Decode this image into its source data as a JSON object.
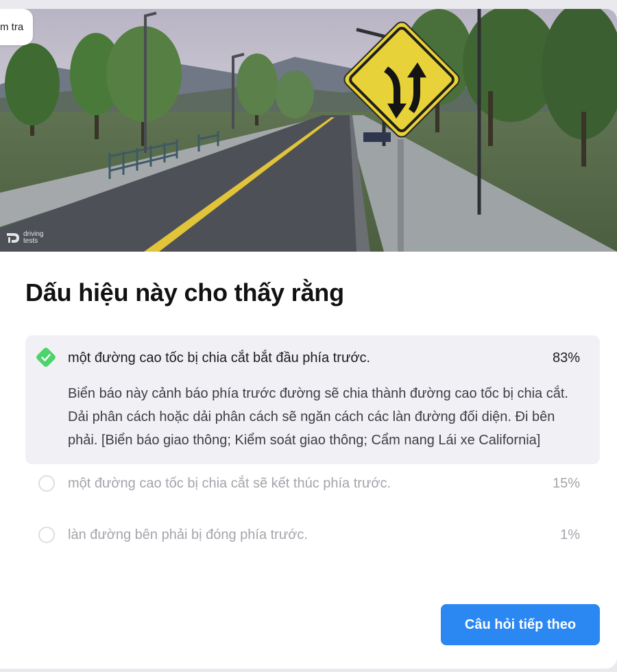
{
  "hero": {
    "badge_text": "m tra",
    "watermark_line1": "driving",
    "watermark_line2": "tests"
  },
  "question": {
    "title": "Dấu hiệu này cho thấy rằng"
  },
  "answers": [
    {
      "text": "một đường cao tốc bị chia cắt bắt đầu phía trước.",
      "percent": "83%",
      "state": "correct",
      "explanation": "Biển báo này cảnh báo phía trước đường sẽ chia thành đường cao tốc bị chia cắt. Dải phân cách hoặc dải phân cách sẽ ngăn cách các làn đường đối diện. Đi bên phải. [Biển báo giao thông; Kiểm soát giao thông; Cẩm nang Lái xe California]"
    },
    {
      "text": "một đường cao tốc bị chia cắt sẽ kết thúc phía trước.",
      "percent": "15%",
      "state": "unselected"
    },
    {
      "text": "làn đường bên phải bị đóng phía trước.",
      "percent": "1%",
      "state": "unselected"
    }
  ],
  "actions": {
    "next_label": "Câu hỏi tiếp theo"
  },
  "colors": {
    "accent": "#2b87f2",
    "correct": "#4cd46b",
    "sign_yellow": "#e8d23a"
  }
}
